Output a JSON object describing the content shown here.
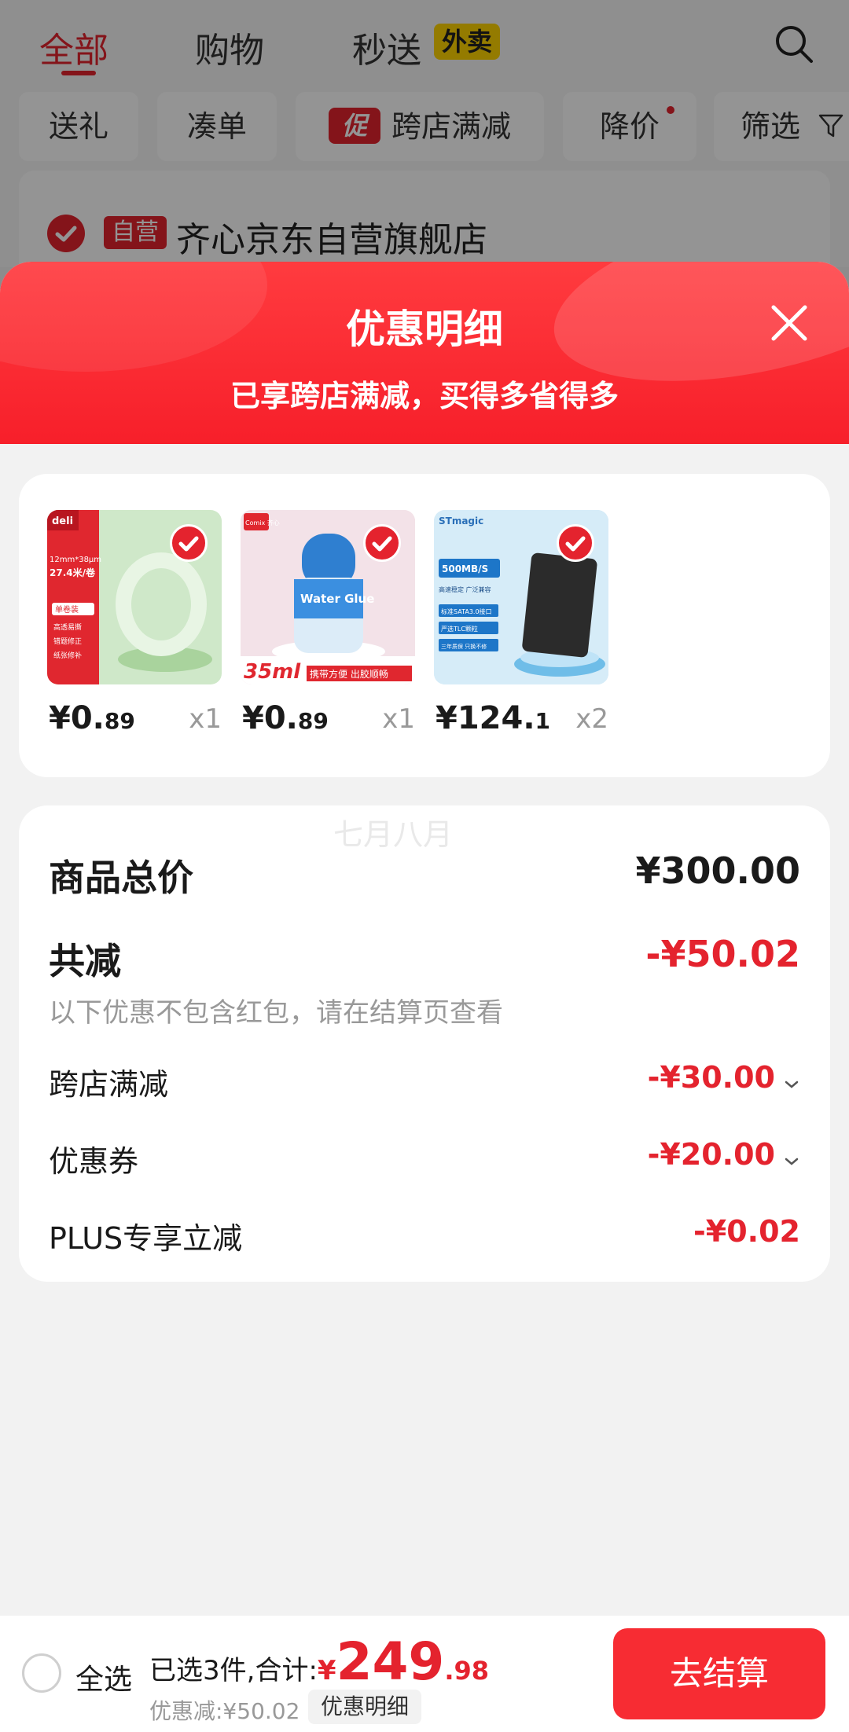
{
  "background": {
    "tabs": [
      {
        "label": "全部",
        "active": true
      },
      {
        "label": "购物"
      },
      {
        "label": "秒送"
      }
    ],
    "waimai_badge": "外卖",
    "filters": [
      "送礼",
      "凑单",
      "跨店满减",
      "降价",
      "筛选"
    ],
    "promo_tag": "促",
    "store": {
      "self_tag": "自营",
      "name": "齐心京东自营旗舰店"
    }
  },
  "sheet": {
    "title": "优惠明细",
    "subtitle": "已享跨店满减，买得多省得多"
  },
  "products": [
    {
      "price_main": "¥0.",
      "price_small": "89",
      "qty": "x1",
      "thumb_text": [
        "deli",
        "12mm*38μm",
        "27.4米/卷",
        "单卷装",
        "高透易撕",
        "错题修正",
        "纸张修补"
      ]
    },
    {
      "price_main": "¥0.",
      "price_small": "89",
      "qty": "x1",
      "thumb_text": [
        "Comix 齐心",
        "Water Glue",
        "35ml",
        "携带方便 出胶顺畅"
      ]
    },
    {
      "price_main": "¥124.",
      "price_small": "1",
      "qty": "x2",
      "thumb_text": [
        "STmagic",
        "500MB/S",
        "高速稳定 广泛兼容",
        "标准SATA3.0接口",
        "严选TLC颗粒",
        "三年质保 只换不修"
      ]
    }
  ],
  "summary": {
    "watermark": "七月八月",
    "total_label": "商品总价",
    "total_value": "¥300.00",
    "reduction_label": "共减",
    "reduction_value": "-¥50.02",
    "note": "以下优惠不包含红包，请在结算页查看",
    "items": [
      {
        "label": "跨店满减",
        "value": "-¥30.00",
        "expandable": true
      },
      {
        "label": "优惠券",
        "value": "-¥20.00",
        "expandable": true
      },
      {
        "label": "PLUS专享立减",
        "value": "-¥0.02",
        "expandable": false
      }
    ]
  },
  "bottom": {
    "select_all": "全选",
    "selected_prefix": "已选3件,合计:",
    "yen": "¥",
    "total_int": "249",
    "total_dec": ".98",
    "discount": "优惠减:¥50.02",
    "detail_button": "优惠明细",
    "checkout": "去结算"
  },
  "colors": {
    "accent": "#e4232e",
    "header": "#f71f2a",
    "checkout": "#f72c33"
  }
}
